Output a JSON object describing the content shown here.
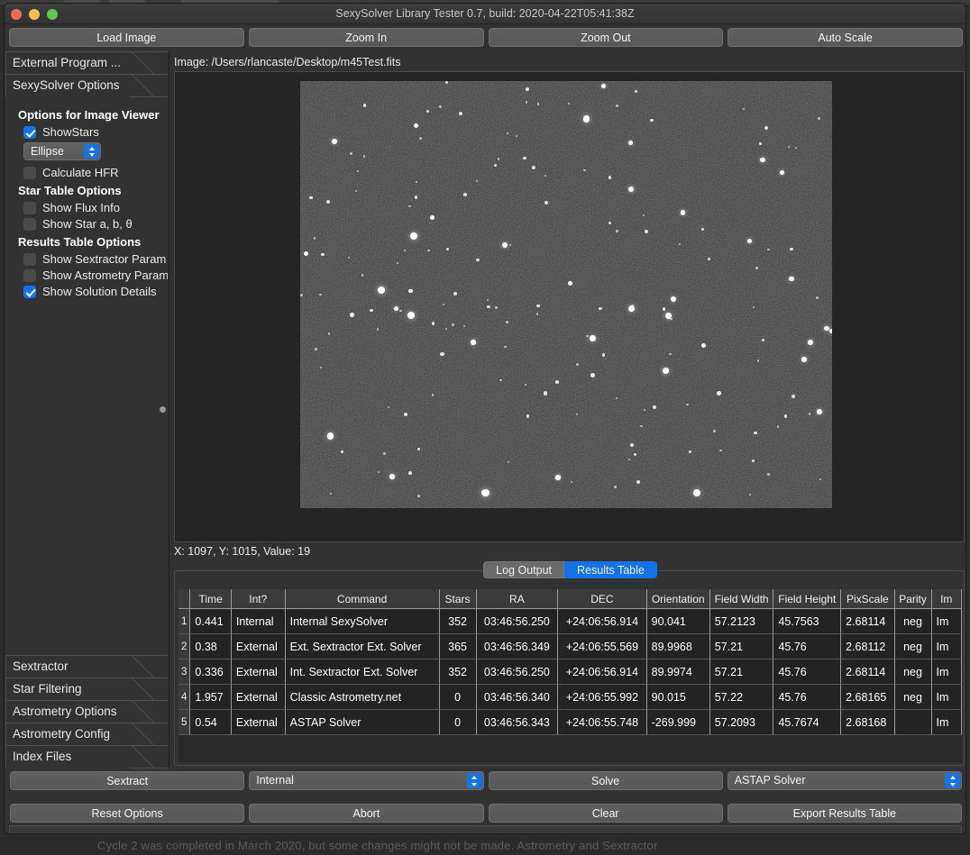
{
  "window": {
    "title": "SexySolver Library Tester 0.7, build: 2020-04-22T05:41:38Z"
  },
  "toolbar": {
    "buttons": [
      {
        "label": "Load Image"
      },
      {
        "label": "Zoom In"
      },
      {
        "label": "Zoom Out"
      },
      {
        "label": "Auto Scale"
      }
    ]
  },
  "sidebar": {
    "top_sections": [
      {
        "label": "External Program ..."
      },
      {
        "label": "SexySolver Options"
      }
    ],
    "groups": [
      {
        "title": "Options for Image Viewer",
        "items": [
          {
            "type": "checkbox",
            "label": "ShowStars",
            "checked": true
          },
          {
            "type": "combo",
            "value": "Ellipse"
          },
          {
            "type": "checkbox",
            "label": "Calculate HFR",
            "checked": false
          }
        ]
      },
      {
        "title": "Star Table Options",
        "items": [
          {
            "type": "checkbox",
            "label": "Show Flux Info",
            "checked": false
          },
          {
            "type": "checkbox",
            "label": "Show Star a, b, θ",
            "checked": false
          }
        ]
      },
      {
        "title": "Results Table Options",
        "items": [
          {
            "type": "checkbox",
            "label": "Show Sextractor Param",
            "checked": false
          },
          {
            "type": "checkbox",
            "label": "Show Astrometry Param",
            "checked": false
          },
          {
            "type": "checkbox",
            "label": "Show Solution Details",
            "checked": true
          }
        ]
      }
    ],
    "bottom_sections": [
      {
        "label": "Sextractor"
      },
      {
        "label": "Star Filtering"
      },
      {
        "label": "Astrometry Options"
      },
      {
        "label": "Astrometry Config"
      },
      {
        "label": "Index Files"
      }
    ]
  },
  "main": {
    "image_path_label": "Image: /Users/rlancaste/Desktop/m45Test.fits",
    "coords_label": "X: 1097, Y: 1015, Value: 19"
  },
  "results_panel": {
    "tabs": [
      {
        "label": "Log Output",
        "active": false
      },
      {
        "label": "Results Table",
        "active": true
      }
    ],
    "table": {
      "columns": [
        "Time",
        "Int?",
        "Command",
        "Stars",
        "RA",
        "DEC",
        "Orientation",
        "Field Width",
        "Field Height",
        "PixScale",
        "Parity",
        "Im"
      ],
      "rows": [
        {
          "num": "1",
          "time": "0.441",
          "int": "Internal",
          "command": "Internal SexySolver",
          "stars": "352",
          "ra": "03:46:56.250",
          "dec": "+24:06:56.914",
          "orientation": "90.041",
          "field_width": "57.2123",
          "field_height": "45.7563",
          "pixscale": "2.68114",
          "parity": "neg",
          "im": "Im"
        },
        {
          "num": "2",
          "time": "0.38",
          "int": "External",
          "command": "Ext. Sextractor Ext. Solver",
          "stars": "365",
          "ra": "03:46:56.349",
          "dec": "+24:06:55.569",
          "orientation": "89.9968",
          "field_width": "57.21",
          "field_height": "45.76",
          "pixscale": "2.68112",
          "parity": "neg",
          "im": "Im"
        },
        {
          "num": "3",
          "time": "0.336",
          "int": "External",
          "command": "Int. Sextractor Ext. Solver",
          "stars": "352",
          "ra": "03:46:56.250",
          "dec": "+24:06:56.914",
          "orientation": "89.9974",
          "field_width": "57.21",
          "field_height": "45.76",
          "pixscale": "2.68114",
          "parity": "neg",
          "im": "Im"
        },
        {
          "num": "4",
          "time": "1.957",
          "int": "External",
          "command": "Classic Astrometry.net",
          "stars": "0",
          "ra": "03:46:56.340",
          "dec": "+24:06:55.992",
          "orientation": "90.015",
          "field_width": "57.22",
          "field_height": "45.76",
          "pixscale": "2.68165",
          "parity": "neg",
          "im": "Im"
        },
        {
          "num": "5",
          "time": "0.54",
          "int": "External",
          "command": "ASTAP Solver",
          "stars": "0",
          "ra": "03:46:56.343",
          "dec": "+24:06:55.748",
          "orientation": "-269.999",
          "field_width": "57.2093",
          "field_height": "45.7674",
          "pixscale": "2.68168",
          "parity": "",
          "im": "Im"
        }
      ]
    }
  },
  "actions": {
    "row1": [
      {
        "type": "button",
        "label": "Sextract"
      },
      {
        "type": "combo",
        "value": "Internal"
      },
      {
        "type": "button",
        "label": "Solve"
      },
      {
        "type": "combo",
        "value": "ASTAP Solver"
      }
    ],
    "row2": [
      {
        "type": "button",
        "label": "Reset Options"
      },
      {
        "type": "button",
        "label": "Abort"
      },
      {
        "type": "button",
        "label": "Clear"
      },
      {
        "type": "button",
        "label": "Export Results Table"
      }
    ]
  },
  "background": {
    "faint_text": "Cycle 2 was completed in March 2020, but some changes might not be made. Astrometry and Sextractor"
  },
  "colors": {
    "accent": "#1473e6",
    "window_bg": "#323232",
    "button_bg": "#5c5c5c",
    "table_cell_bg": "#232323"
  }
}
